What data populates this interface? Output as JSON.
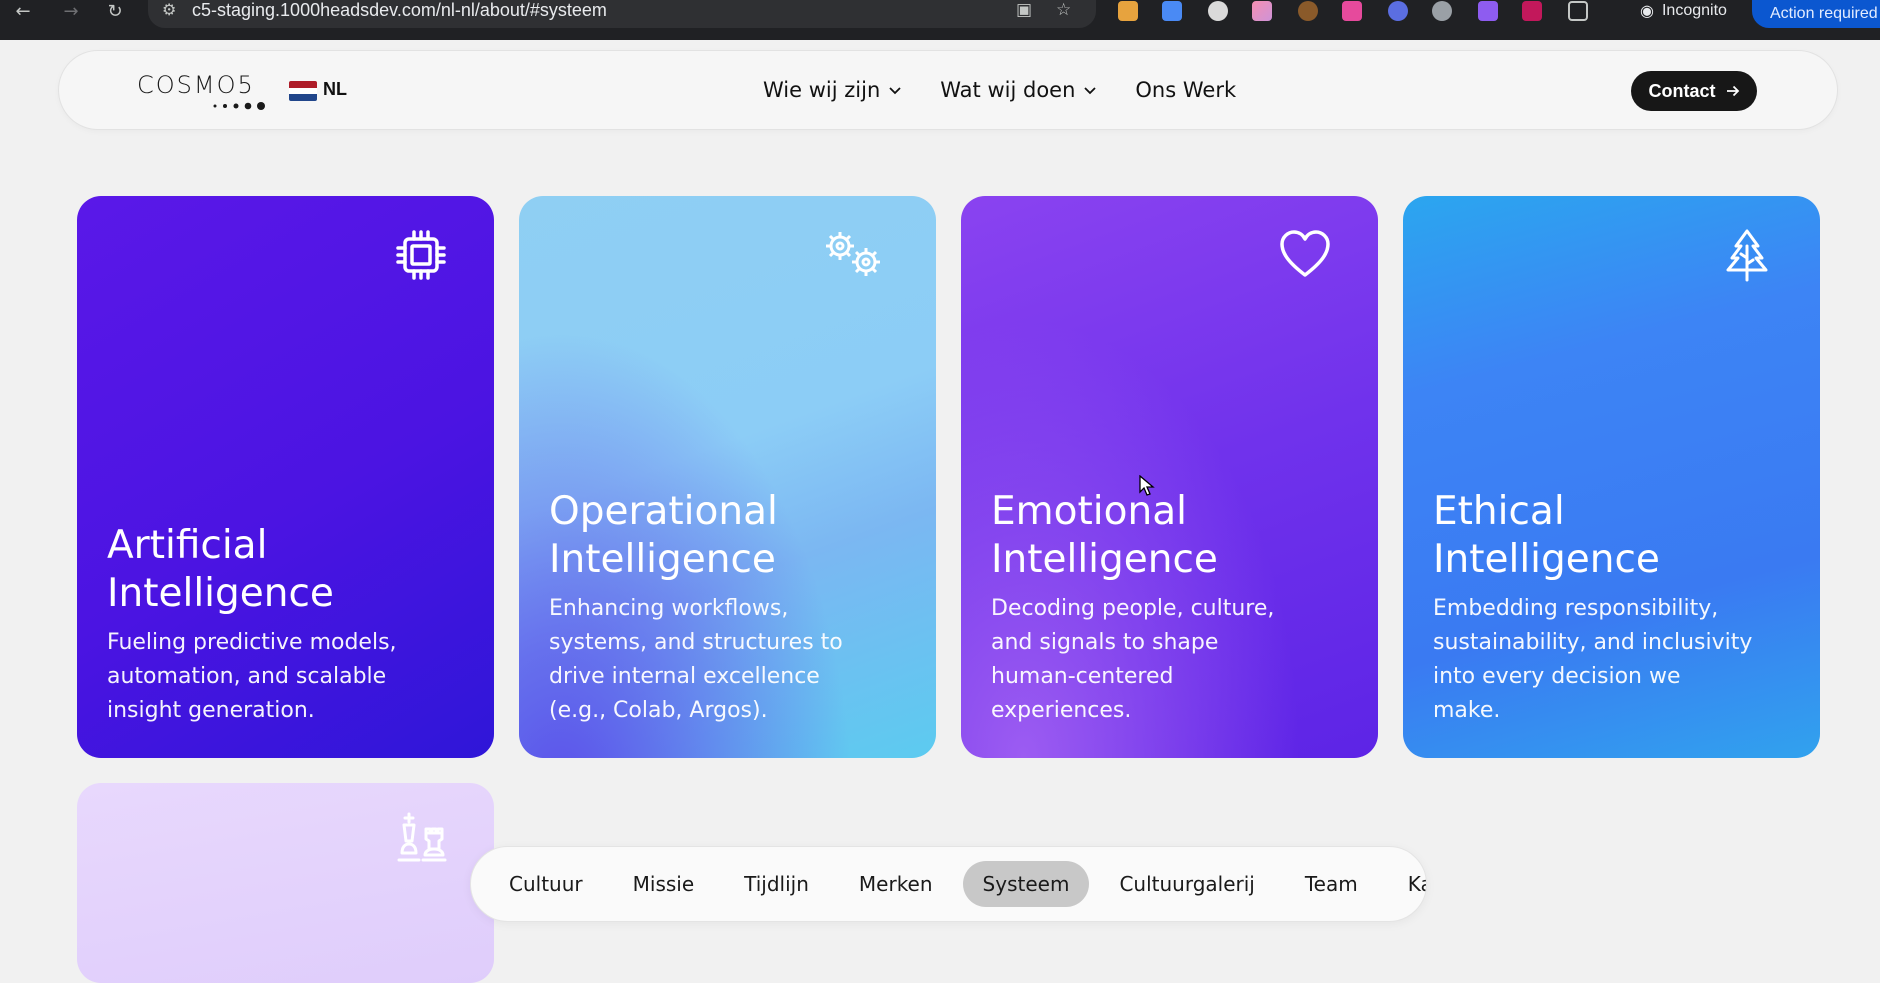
{
  "browser": {
    "url": "c5-staging.1000headsdev.com/nl-nl/about/#systeem",
    "incognito_label": "Incognito",
    "action_label": "Action required"
  },
  "header": {
    "logo_text": "COSMO5",
    "lang_label": "NL",
    "nav": [
      {
        "label": "Wie wij zijn",
        "has_dropdown": true
      },
      {
        "label": "Wat wij doen",
        "has_dropdown": true
      },
      {
        "label": "Ons Werk",
        "has_dropdown": false
      }
    ],
    "contact_label": "Contact"
  },
  "cards": [
    {
      "title_line1": "Artificial",
      "title_line2": "Intelligence",
      "desc": [
        "Fueling predictive models,",
        "automation, and scalable",
        "insight generation."
      ],
      "icon": "chip-icon"
    },
    {
      "title_line1": "Operational",
      "title_line2": "Intelligence",
      "desc": [
        "Enhancing workflows,",
        "systems, and structures to",
        "drive internal excellence",
        "(e.g., Colab, Argos)."
      ],
      "icon": "gears-icon"
    },
    {
      "title_line1": "Emotional",
      "title_line2": "Intelligence",
      "desc": [
        "Decoding people, culture,",
        "and signals to shape",
        "human-centered",
        "experiences."
      ],
      "icon": "heart-icon"
    },
    {
      "title_line1": "Ethical",
      "title_line2": "Intelligence",
      "desc": [
        "Embedding responsibility,",
        "sustainability, and inclusivity",
        "into every decision we",
        "make."
      ],
      "icon": "tree-icon"
    },
    {
      "icon": "chess-icon"
    }
  ],
  "subnav": {
    "items": [
      "Cultuur",
      "Missie",
      "Tijdlijn",
      "Merken",
      "Systeem",
      "Cultuurgalerij",
      "Team",
      "Ka"
    ],
    "active": "Systeem"
  },
  "colors": {
    "brand_dark": "#171717",
    "purple": "#5a18e8",
    "blue": "#3a7af2"
  }
}
